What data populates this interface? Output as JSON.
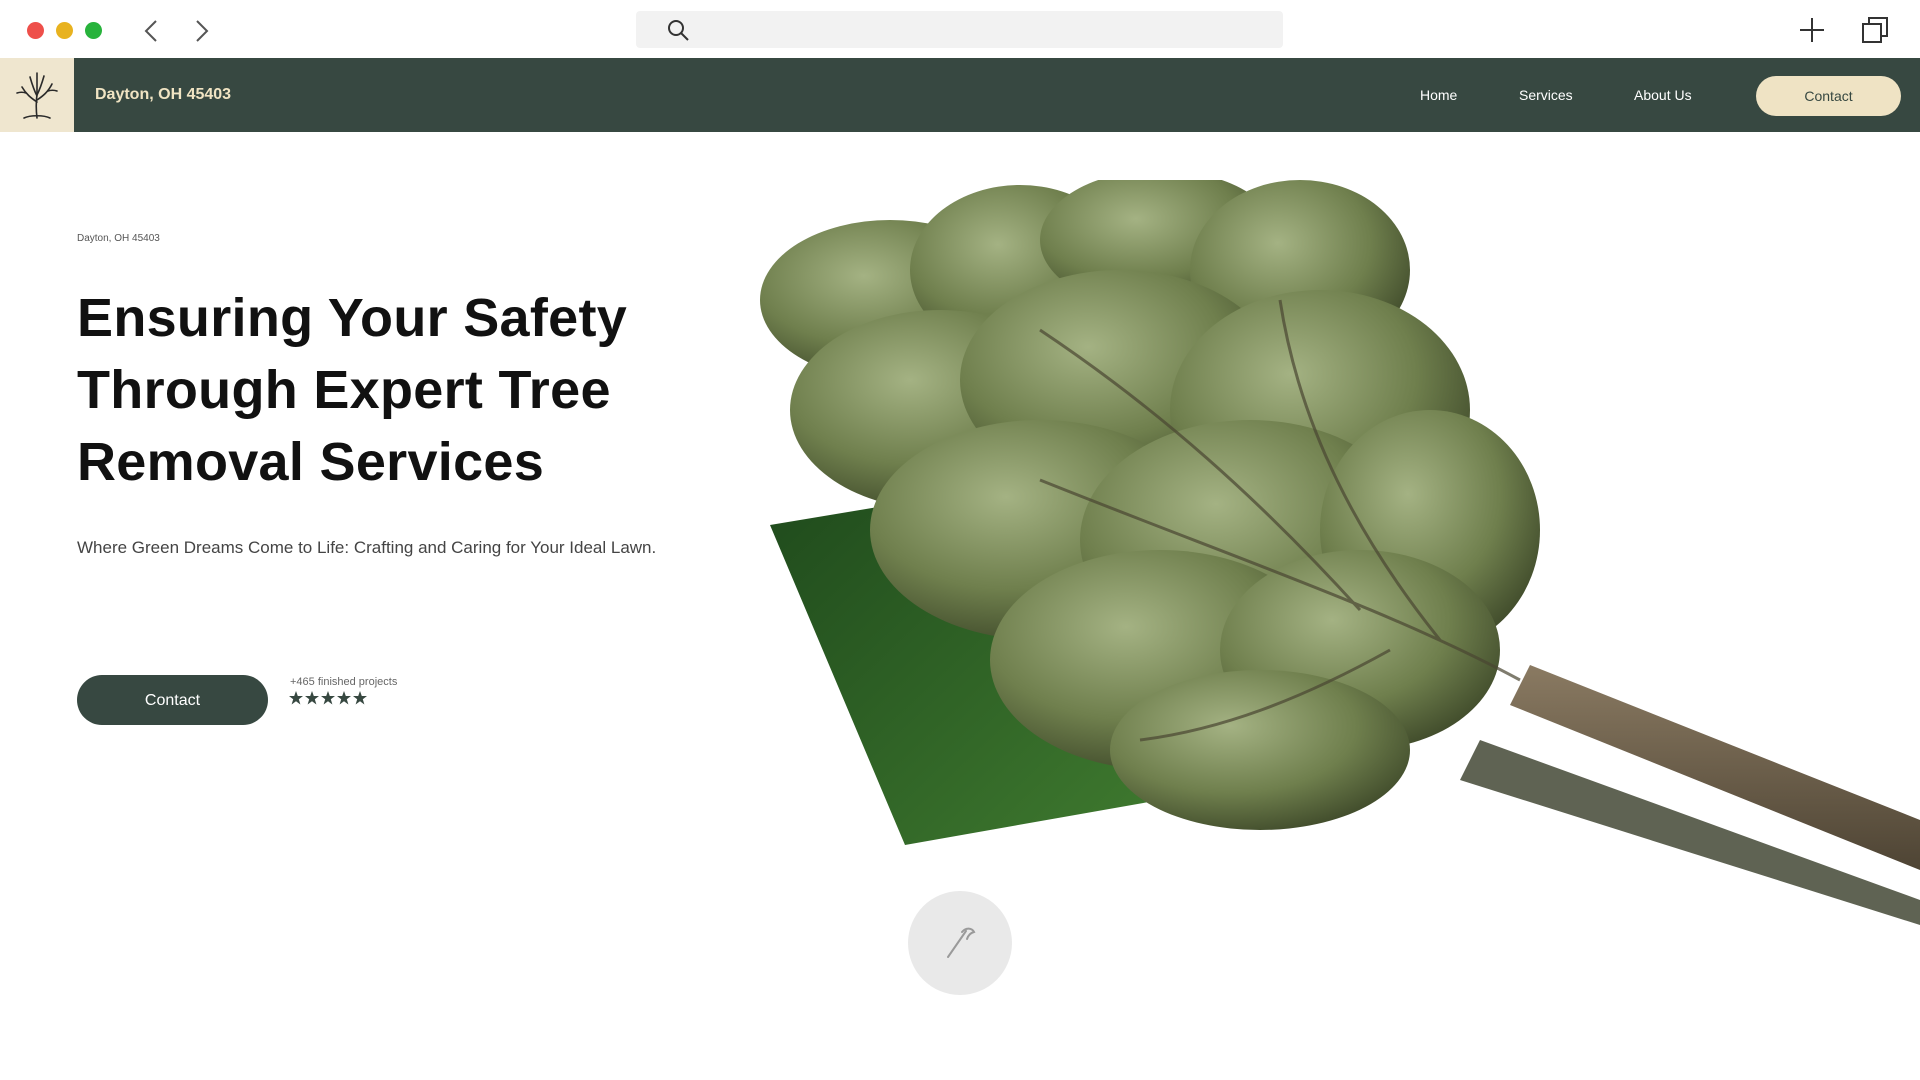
{
  "browser": {
    "url": ""
  },
  "header": {
    "brand": "Dayton, OH 45403",
    "nav": {
      "home": "Home",
      "services": "Services",
      "about": "About Us",
      "contact": "Contact"
    }
  },
  "hero": {
    "location": "Dayton, OH 45403",
    "title": "Ensuring Your Safety Through Expert Tree Removal Services",
    "subtitle": "Where Green Dreams Come to Life: Crafting and Caring for Your Ideal Lawn.",
    "contact_label": "Contact",
    "projects_label": "+465 finished projects",
    "rating": 5
  },
  "colors": {
    "header_bg": "#374841",
    "accent_cream": "#efe3c4"
  },
  "icons": {
    "logo": "tree-logo-icon",
    "floating": "axe-icon"
  }
}
